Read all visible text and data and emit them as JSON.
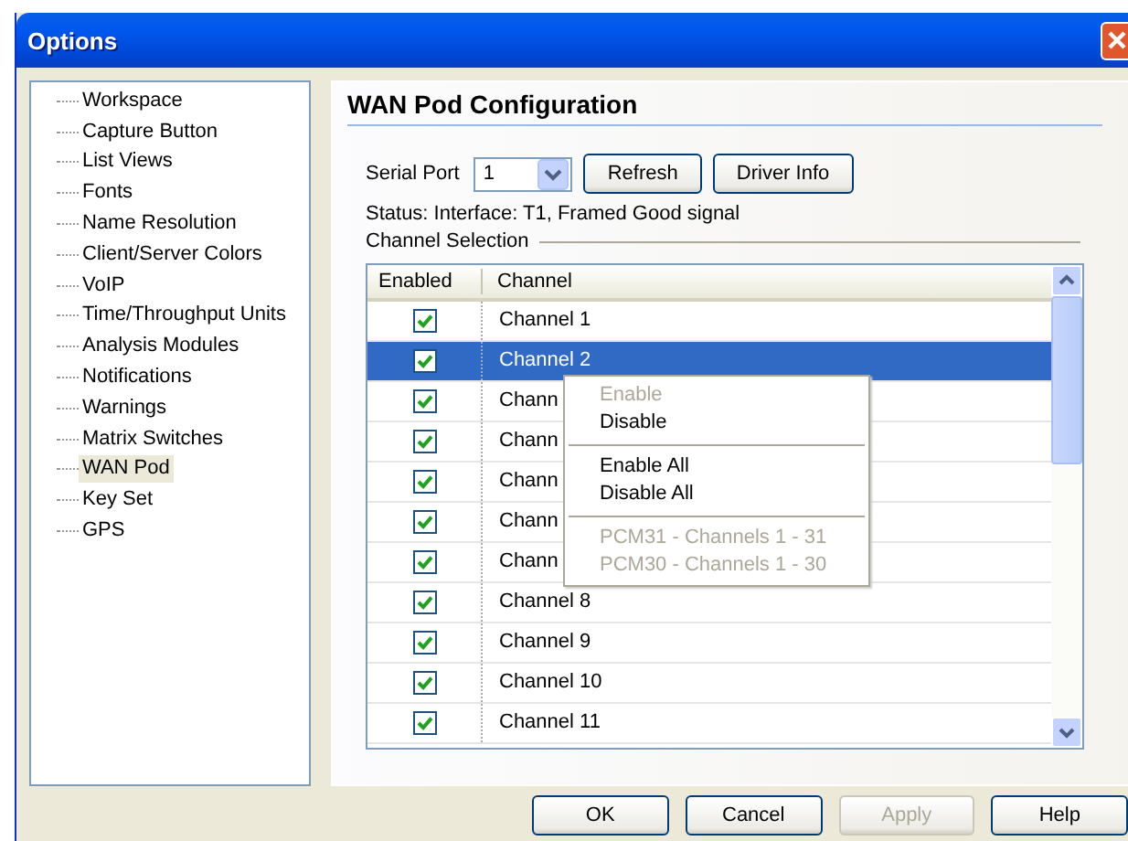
{
  "window": {
    "title": "Options"
  },
  "sidebar": {
    "items": [
      {
        "label": "Workspace",
        "selected": false
      },
      {
        "label": "Capture Button",
        "selected": false
      },
      {
        "label": "List Views",
        "selected": false
      },
      {
        "label": "Fonts",
        "selected": false
      },
      {
        "label": "Name Resolution",
        "selected": false
      },
      {
        "label": "Client/Server Colors",
        "selected": false
      },
      {
        "label": "VoIP",
        "selected": false
      },
      {
        "label": "Time/Throughput Units",
        "selected": false
      },
      {
        "label": "Analysis Modules",
        "selected": false
      },
      {
        "label": "Notifications",
        "selected": false
      },
      {
        "label": "Warnings",
        "selected": false
      },
      {
        "label": "Matrix Switches",
        "selected": false
      },
      {
        "label": "WAN Pod",
        "selected": true
      },
      {
        "label": "Key Set",
        "selected": false
      },
      {
        "label": "GPS",
        "selected": false
      }
    ]
  },
  "panel": {
    "title": "WAN Pod Configuration",
    "serial_port": {
      "label": "Serial Port",
      "value": "1"
    },
    "buttons": [
      {
        "label": "Refresh"
      },
      {
        "label": "Driver Info"
      }
    ],
    "status": "Status: Interface: T1, Framed Good signal",
    "group_label": "Channel Selection",
    "table": {
      "columns": [
        "Enabled",
        "Channel"
      ],
      "rows": [
        {
          "checked": true,
          "channel": "Channel 1",
          "selected": false
        },
        {
          "checked": true,
          "channel": "Channel 2",
          "selected": true
        },
        {
          "checked": true,
          "channel": "Chann",
          "selected": false
        },
        {
          "checked": true,
          "channel": "Chann",
          "selected": false
        },
        {
          "checked": true,
          "channel": "Chann",
          "selected": false
        },
        {
          "checked": true,
          "channel": "Chann",
          "selected": false
        },
        {
          "checked": true,
          "channel": "Chann",
          "selected": false
        },
        {
          "checked": true,
          "channel": "Channel 8",
          "selected": false
        },
        {
          "checked": true,
          "channel": "Channel 9",
          "selected": false
        },
        {
          "checked": true,
          "channel": "Channel 10",
          "selected": false
        },
        {
          "checked": true,
          "channel": "Channel 11",
          "selected": false
        }
      ]
    },
    "context_menu": {
      "items": [
        {
          "kind": "item",
          "label": "Enable",
          "disabled": true
        },
        {
          "kind": "item",
          "label": "Disable",
          "disabled": false
        },
        {
          "kind": "separator"
        },
        {
          "kind": "item",
          "label": "Enable All",
          "disabled": false
        },
        {
          "kind": "item",
          "label": "Disable All",
          "disabled": false
        },
        {
          "kind": "separator"
        },
        {
          "kind": "item",
          "label": "PCM31 - Channels 1 - 31",
          "disabled": true
        },
        {
          "kind": "item",
          "label": "PCM30 - Channels 1 - 30",
          "disabled": true
        }
      ]
    }
  },
  "footer_buttons": [
    {
      "label": "OK",
      "disabled": false
    },
    {
      "label": "Cancel",
      "disabled": false
    },
    {
      "label": "Apply",
      "disabled": true
    },
    {
      "label": "Help",
      "disabled": false
    }
  ]
}
